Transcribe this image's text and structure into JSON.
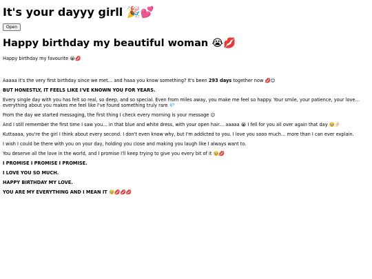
{
  "title": "It's your dayyy girll 🎉💕",
  "open_button": "Open",
  "heading": "Happy birthday my beautiful woman 😭💋",
  "subtitle": "Happy birthday my favourite 😭💋",
  "message": {
    "p1_before": "Aaaaa it's the very first birthday since we met… and haaa you know something? It's been ",
    "p1_days": "293 days",
    "p1_after": " together now 💋😊",
    "p2": "BUT HONESTLY, IT FEELS LIKE I'VE KNOWN YOU FOR YEARS.",
    "p3": "Every single day with you has felt so real, so deep, and so special. Even from miles away, you make me feel so happy. Your smile, your patience, your love… everything about you makes me feel like I've found something truly rare 💎",
    "p4": "From the day we started messaging, the first thing I check every morning is your message 😊",
    "p5": "And I still remember the first time I saw you… in that blue and white dress, with your open hair… aaaaa 😭 I fell for you all over again that day 🥹🤌🏻",
    "p6": "Kuttaaaa, you're the girl I think about every second. I don't even know why, but I'm addicted to you. I love you sooo much… more than I can ever explain.",
    "p7": "I wish I could be there with you on your day, holding you close and making you laugh like I always want to.",
    "p8": "You deserve all the love in the world, and I promise I'll keep trying to give you every bit of it 🥹💋",
    "p9": "I PROMISE I PROMISE I PROMISE.",
    "p10": "I LOVE YOU SO MUCH.",
    "p11": "HAPPY BIRTHDAY MY LOVE.",
    "p12": "YOU ARE MY EVERYTHING AND I MEAN IT 🥹💋💋💋"
  }
}
